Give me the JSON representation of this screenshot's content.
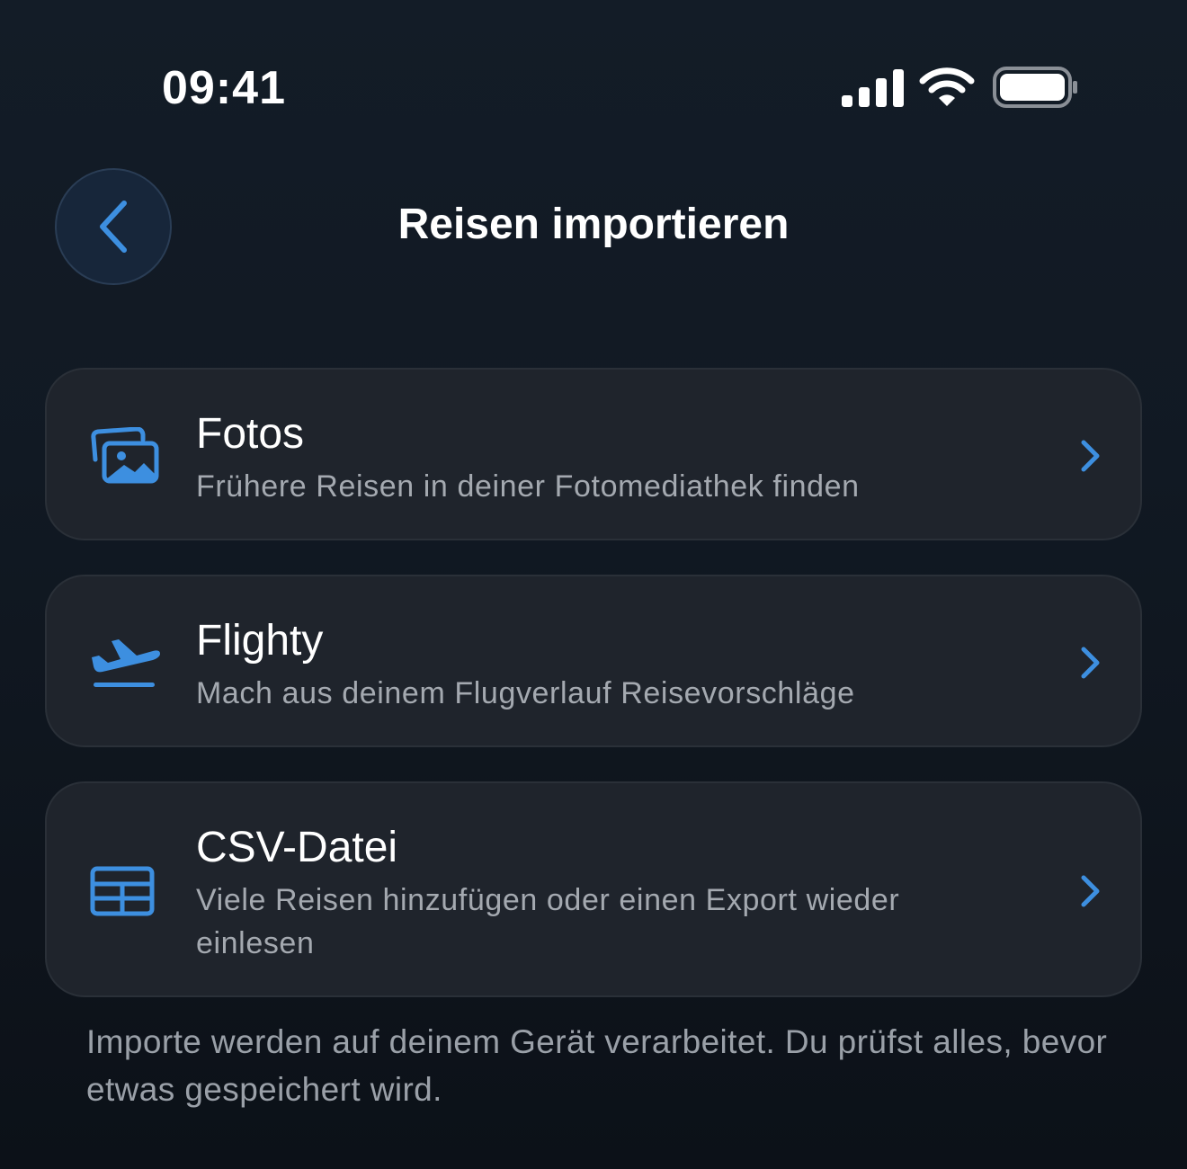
{
  "status_bar": {
    "time": "09:41",
    "icons": [
      "signal-icon",
      "wifi-icon",
      "battery-icon"
    ]
  },
  "header": {
    "back_icon": "chevron-left-icon",
    "title": "Reisen importieren"
  },
  "options": [
    {
      "icon": "photos-icon",
      "title": "Fotos",
      "subtitle": "Frühere Reisen in deiner Fotomediathek finden"
    },
    {
      "icon": "airplane-departure-icon",
      "title": "Flighty",
      "subtitle": "Mach aus deinem Flugverlauf Reisevorschläge"
    },
    {
      "icon": "table-icon",
      "title": "CSV-Datei",
      "subtitle": "Viele Reisen hinzufügen oder einen Export wieder einlesen"
    }
  ],
  "footer": {
    "note": "Importe werden auf deinem Gerät verarbeitet. Du prüfst alles, bevor etwas gespeichert wird."
  },
  "colors": {
    "accent": "#3d8fe0",
    "card_background": "#1f242c",
    "secondary_text": "#a4a9b0"
  }
}
